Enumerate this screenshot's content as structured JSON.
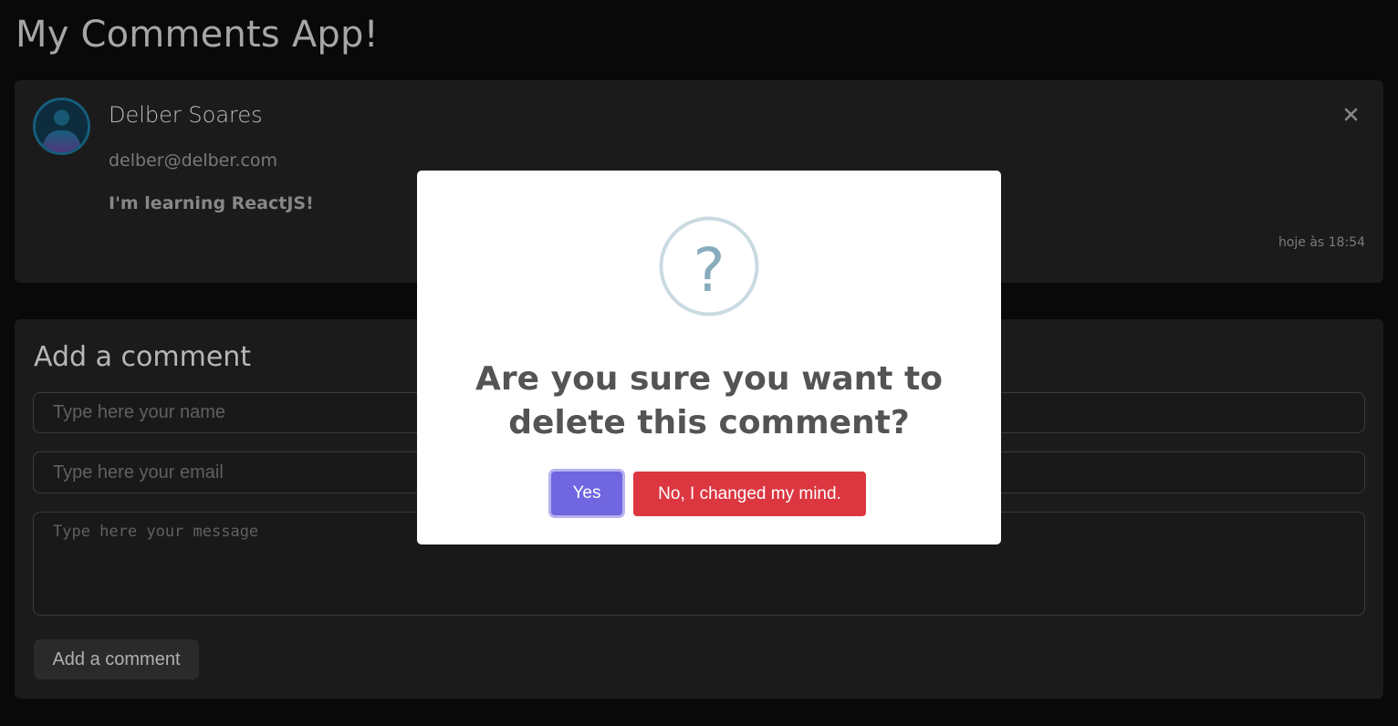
{
  "app": {
    "title": "My Comments App!"
  },
  "comment": {
    "author": "Delber Soares",
    "email": "delber@delber.com",
    "message": "I'm learning ReactJS!",
    "time": "hoje às 18:54",
    "avatar_icon": "user-avatar-icon",
    "close_icon": "close-icon"
  },
  "form": {
    "title": "Add a comment",
    "name_placeholder": "Type here your name",
    "email_placeholder": "Type here your email",
    "message_placeholder": "Type here your message",
    "submit_label": "Add a comment"
  },
  "dialog": {
    "icon": "question-icon",
    "title": "Are you sure you want to delete this comment?",
    "confirm_label": "Yes",
    "cancel_label": "No, I changed my mind.",
    "colors": {
      "confirm": "#7066e0",
      "cancel": "#dc3741",
      "icon": "#87adbd"
    }
  }
}
